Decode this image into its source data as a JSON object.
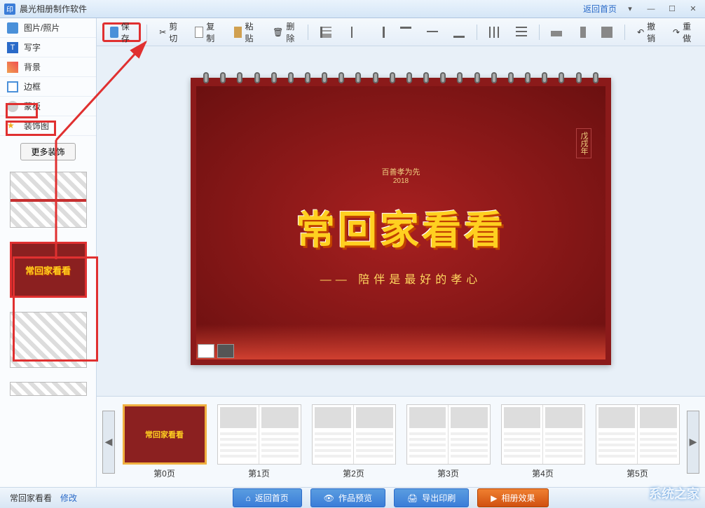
{
  "app": {
    "title": "晨光相册制作软件",
    "icon_text": "印"
  },
  "titlebar": {
    "home_link": "返回首页"
  },
  "sidebar": {
    "items": [
      {
        "label": "图片/照片",
        "icon": "photo"
      },
      {
        "label": "写字",
        "icon": "text"
      },
      {
        "label": "背景",
        "icon": "bg"
      },
      {
        "label": "边框",
        "icon": "border"
      },
      {
        "label": "蒙板",
        "icon": "mask"
      },
      {
        "label": "装饰图",
        "icon": "star"
      }
    ],
    "more_button": "更多装饰"
  },
  "toolbar": {
    "save": "保存",
    "cut": "剪切",
    "copy": "复制",
    "paste": "粘贴",
    "delete": "删除",
    "undo": "撤销",
    "redo": "重做"
  },
  "canvas": {
    "subtitle": "百善孝为先",
    "year": "2018",
    "main_title": "常回家看看",
    "tagline": "—— 陪伴是最好的孝心",
    "stamp": "戊戌年"
  },
  "pages": {
    "items": [
      {
        "label": "第0页",
        "cover": true
      },
      {
        "label": "第1页"
      },
      {
        "label": "第2页"
      },
      {
        "label": "第3页"
      },
      {
        "label": "第4页"
      },
      {
        "label": "第5页"
      }
    ]
  },
  "footer": {
    "project_name": "常回家看看",
    "edit_link": "修改",
    "buttons": {
      "home": "返回首页",
      "preview": "作品预览",
      "export": "导出印刷",
      "effect": "相册效果"
    }
  },
  "watermark": "系统之家"
}
